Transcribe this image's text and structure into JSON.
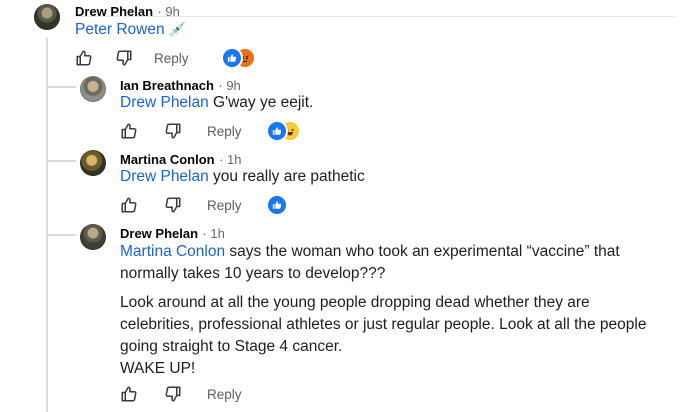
{
  "comments": [
    {
      "author": "Drew Phelan",
      "time": "· 9h",
      "mention": "Peter Rowen",
      "emoji": "💉",
      "reply_label": "Reply",
      "reactions": [
        "like",
        "angry"
      ]
    },
    {
      "author": "Ian Breathnach",
      "time": "· 9h",
      "mention": "Drew Phelan",
      "text": " G'way ye eejit.",
      "reply_label": "Reply",
      "reactions": [
        "like",
        "haha"
      ]
    },
    {
      "author": "Martina Conlon",
      "time": "· 1h",
      "mention": "Drew Phelan",
      "text": " you really are pathetic",
      "reply_label": "Reply",
      "reactions": [
        "like"
      ]
    },
    {
      "author": "Drew Phelan",
      "time": "· 1h",
      "mention": "Martina Conlon",
      "text_line1_rest": " says the woman who took an experimental “vaccine” that",
      "text_line2": "normally takes 10 years to develop???",
      "para2_line1": "Look around at all the young people dropping dead whether they are",
      "para2_line2": "celebrities, professional athletes or just regular people. Look at all the people",
      "para2_line3": "going straight to Stage 4 cancer.",
      "para2_line4": "WAKE UP!",
      "reply_label": "Reply"
    }
  ],
  "icons": {
    "like": "thumbs-up-icon",
    "dislike": "thumbs-down-icon",
    "like_reaction": "like-reaction-icon",
    "angry_reaction": "angry-reaction-icon",
    "haha_reaction": "haha-reaction-icon"
  },
  "colors": {
    "mention": "#1b62d8",
    "like_reaction": "#1877f2",
    "angry_reaction": "#e9710f",
    "haha_reaction": "#f7c93b",
    "thread_line": "#d8dadf"
  }
}
